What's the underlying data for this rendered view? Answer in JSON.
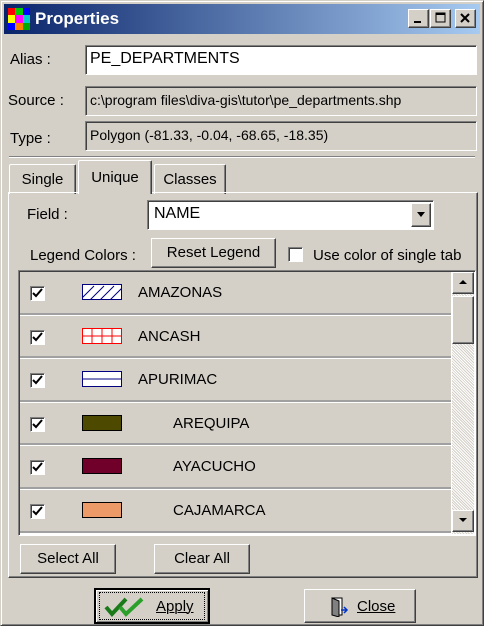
{
  "window": {
    "title": "Properties",
    "icons": {
      "app": "app-grid-icon",
      "minimize": "minimize-icon",
      "maximize": "maximize-icon",
      "close": "close-icon"
    }
  },
  "alias": {
    "label": "Alias :",
    "value": "PE_DEPARTMENTS"
  },
  "source": {
    "label": "Source :",
    "value": "c:\\program files\\diva-gis\\tutor\\pe_departments.shp"
  },
  "type": {
    "label": "Type :",
    "value": "Polygon  (-81.33, -0.04, -68.65, -18.35)"
  },
  "tabs": [
    {
      "label": "Single",
      "active": false
    },
    {
      "label": "Unique",
      "active": true
    },
    {
      "label": "Classes",
      "active": false
    }
  ],
  "unique_tab": {
    "field_label": "Field :",
    "field_value": "NAME",
    "legend_colors_label": "Legend Colors :",
    "reset_legend_label": "Reset Legend",
    "use_single_label": "Use color of single tab",
    "use_single_checked": false,
    "items": [
      {
        "name": "AMAZONAS",
        "checked": true,
        "swatch": "diagonal-hatch",
        "color": "#000080"
      },
      {
        "name": "ANCASH",
        "checked": true,
        "swatch": "grid-hatch",
        "color": "#ff0000"
      },
      {
        "name": "APURIMAC",
        "checked": true,
        "swatch": "horizontal-line",
        "color": "#000080"
      },
      {
        "name": "AREQUIPA",
        "checked": true,
        "swatch": "solid",
        "color": "#4d4a00"
      },
      {
        "name": "AYACUCHO",
        "checked": true,
        "swatch": "solid",
        "color": "#70002a"
      },
      {
        "name": "CAJAMARCA",
        "checked": true,
        "swatch": "solid",
        "color": "#eb9a68"
      }
    ],
    "select_all_label": "Select All",
    "clear_all_label": "Clear All"
  },
  "footer": {
    "apply_label": "Apply",
    "apply_icon": "double-check-icon",
    "close_label": "Close",
    "close_icon": "door-exit-icon"
  }
}
